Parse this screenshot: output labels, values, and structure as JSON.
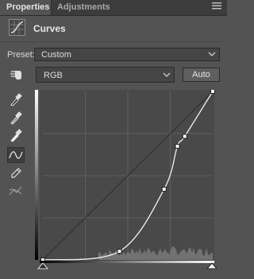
{
  "tabs": [
    {
      "label": "Properties",
      "active": true
    },
    {
      "label": "Adjustments",
      "active": false
    }
  ],
  "panel_menu_icon": "panel-menu-icon",
  "header": {
    "title": "Curves",
    "icon": "curves-adjustment-icon"
  },
  "preset": {
    "label": "Preset:",
    "value": "Custom"
  },
  "channel": {
    "value": "RGB"
  },
  "auto_button": {
    "label": "Auto"
  },
  "tools": [
    {
      "name": "on-image-adjustment-icon",
      "selected": false
    },
    {
      "name": "black-point-eyedropper-icon",
      "selected": false
    },
    {
      "name": "gray-point-eyedropper-icon",
      "selected": false
    },
    {
      "name": "white-point-eyedropper-icon",
      "selected": false
    },
    {
      "name": "edit-points-curve-icon",
      "selected": true
    },
    {
      "name": "draw-pencil-icon",
      "selected": false
    },
    {
      "name": "smooth-curve-icon",
      "selected": false
    }
  ],
  "curve": {
    "input_range": [
      0,
      255
    ],
    "output_range": [
      0,
      255
    ],
    "control_points": [
      {
        "input": 0,
        "output": 0
      },
      {
        "input": 115,
        "output": 13
      },
      {
        "input": 182,
        "output": 107
      },
      {
        "input": 202,
        "output": 172
      },
      {
        "input": 213,
        "output": 187
      },
      {
        "input": 255,
        "output": 255
      }
    ],
    "colors": {
      "background": "#494949",
      "grid": "#5e5e5e",
      "curve": "#f2f2f2",
      "histogram": "#727272"
    }
  }
}
